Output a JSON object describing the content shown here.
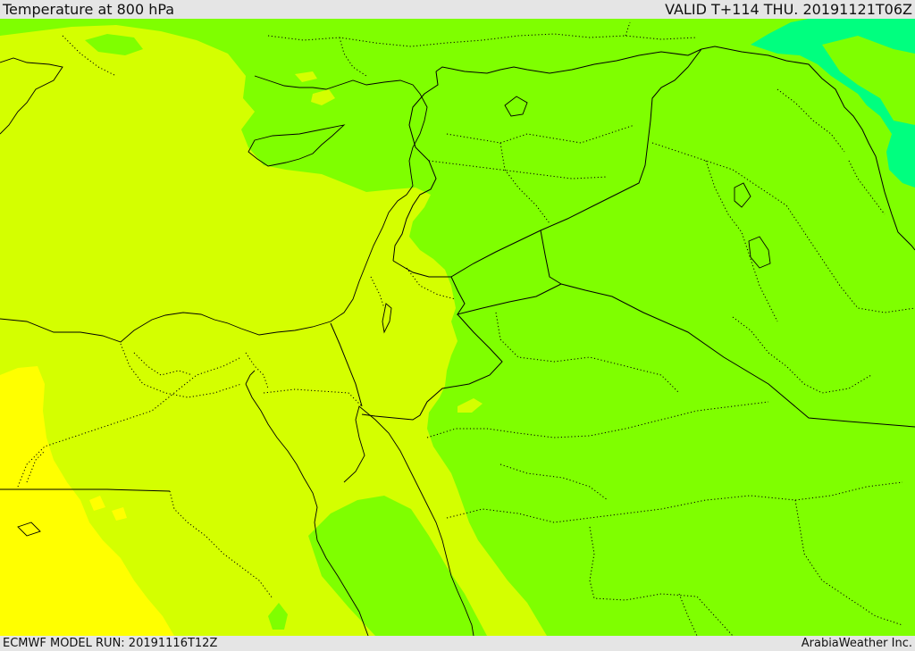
{
  "header": {
    "title": "Temperature at 800 hPa",
    "valid": "VALID T+114 THU. 20191121T06Z"
  },
  "footer": {
    "model_run": "ECMWF MODEL RUN: 20191116T12Z",
    "credit": "ArabiaWeather Inc."
  },
  "colors": {
    "warm_yellow": "#ffff00",
    "yellow_green": "#d4ff00",
    "green": "#7fff00",
    "cool_green": "#00ff7f",
    "bar_background": "#e5e5e5"
  }
}
